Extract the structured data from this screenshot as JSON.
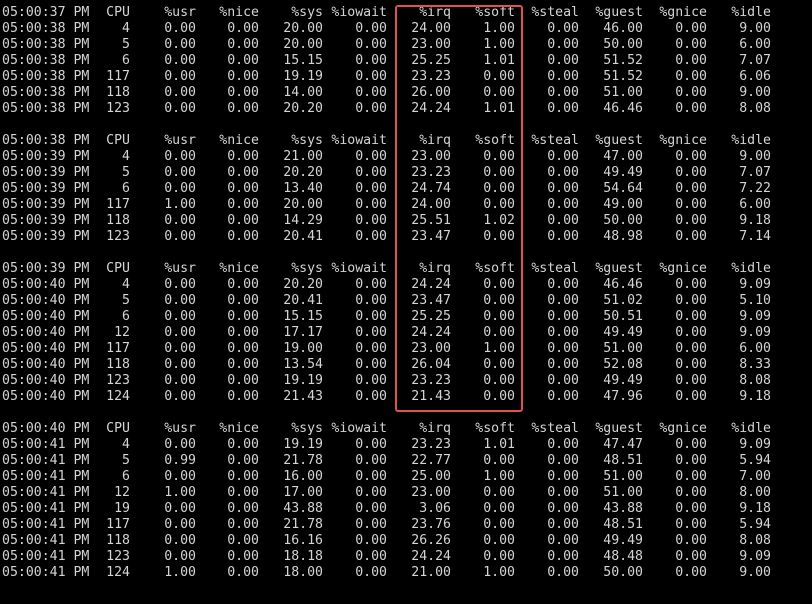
{
  "highlight_color": "#e0524f",
  "blocks": [
    {
      "header": [
        "05:00:37 PM",
        "CPU",
        "%usr",
        "%nice",
        "%sys",
        "%iowait",
        "%irq",
        "%soft",
        "%steal",
        "%guest",
        "%gnice",
        "%idle"
      ],
      "rows": [
        [
          "05:00:38 PM",
          "4",
          "0.00",
          "0.00",
          "20.00",
          "0.00",
          "24.00",
          "1.00",
          "0.00",
          "46.00",
          "0.00",
          "9.00"
        ],
        [
          "05:00:38 PM",
          "5",
          "0.00",
          "0.00",
          "20.00",
          "0.00",
          "23.00",
          "1.00",
          "0.00",
          "50.00",
          "0.00",
          "6.00"
        ],
        [
          "05:00:38 PM",
          "6",
          "0.00",
          "0.00",
          "15.15",
          "0.00",
          "25.25",
          "1.01",
          "0.00",
          "51.52",
          "0.00",
          "7.07"
        ],
        [
          "05:00:38 PM",
          "117",
          "0.00",
          "0.00",
          "19.19",
          "0.00",
          "23.23",
          "0.00",
          "0.00",
          "51.52",
          "0.00",
          "6.06"
        ],
        [
          "05:00:38 PM",
          "118",
          "0.00",
          "0.00",
          "14.00",
          "0.00",
          "26.00",
          "0.00",
          "0.00",
          "51.00",
          "0.00",
          "9.00"
        ],
        [
          "05:00:38 PM",
          "123",
          "0.00",
          "0.00",
          "20.20",
          "0.00",
          "24.24",
          "1.01",
          "0.00",
          "46.46",
          "0.00",
          "8.08"
        ]
      ]
    },
    {
      "header": [
        "05:00:38 PM",
        "CPU",
        "%usr",
        "%nice",
        "%sys",
        "%iowait",
        "%irq",
        "%soft",
        "%steal",
        "%guest",
        "%gnice",
        "%idle"
      ],
      "rows": [
        [
          "05:00:39 PM",
          "4",
          "0.00",
          "0.00",
          "21.00",
          "0.00",
          "23.00",
          "0.00",
          "0.00",
          "47.00",
          "0.00",
          "9.00"
        ],
        [
          "05:00:39 PM",
          "5",
          "0.00",
          "0.00",
          "20.20",
          "0.00",
          "23.23",
          "0.00",
          "0.00",
          "49.49",
          "0.00",
          "7.07"
        ],
        [
          "05:00:39 PM",
          "6",
          "0.00",
          "0.00",
          "13.40",
          "0.00",
          "24.74",
          "0.00",
          "0.00",
          "54.64",
          "0.00",
          "7.22"
        ],
        [
          "05:00:39 PM",
          "117",
          "1.00",
          "0.00",
          "20.00",
          "0.00",
          "24.00",
          "0.00",
          "0.00",
          "49.00",
          "0.00",
          "6.00"
        ],
        [
          "05:00:39 PM",
          "118",
          "0.00",
          "0.00",
          "14.29",
          "0.00",
          "25.51",
          "1.02",
          "0.00",
          "50.00",
          "0.00",
          "9.18"
        ],
        [
          "05:00:39 PM",
          "123",
          "0.00",
          "0.00",
          "20.41",
          "0.00",
          "23.47",
          "0.00",
          "0.00",
          "48.98",
          "0.00",
          "7.14"
        ]
      ]
    },
    {
      "header": [
        "05:00:39 PM",
        "CPU",
        "%usr",
        "%nice",
        "%sys",
        "%iowait",
        "%irq",
        "%soft",
        "%steal",
        "%guest",
        "%gnice",
        "%idle"
      ],
      "rows": [
        [
          "05:00:40 PM",
          "4",
          "0.00",
          "0.00",
          "20.20",
          "0.00",
          "24.24",
          "0.00",
          "0.00",
          "46.46",
          "0.00",
          "9.09"
        ],
        [
          "05:00:40 PM",
          "5",
          "0.00",
          "0.00",
          "20.41",
          "0.00",
          "23.47",
          "0.00",
          "0.00",
          "51.02",
          "0.00",
          "5.10"
        ],
        [
          "05:00:40 PM",
          "6",
          "0.00",
          "0.00",
          "15.15",
          "0.00",
          "25.25",
          "0.00",
          "0.00",
          "50.51",
          "0.00",
          "9.09"
        ],
        [
          "05:00:40 PM",
          "12",
          "0.00",
          "0.00",
          "17.17",
          "0.00",
          "24.24",
          "0.00",
          "0.00",
          "49.49",
          "0.00",
          "9.09"
        ],
        [
          "05:00:40 PM",
          "117",
          "0.00",
          "0.00",
          "19.00",
          "0.00",
          "23.00",
          "1.00",
          "0.00",
          "51.00",
          "0.00",
          "6.00"
        ],
        [
          "05:00:40 PM",
          "118",
          "0.00",
          "0.00",
          "13.54",
          "0.00",
          "26.04",
          "0.00",
          "0.00",
          "52.08",
          "0.00",
          "8.33"
        ],
        [
          "05:00:40 PM",
          "123",
          "0.00",
          "0.00",
          "19.19",
          "0.00",
          "23.23",
          "0.00",
          "0.00",
          "49.49",
          "0.00",
          "8.08"
        ],
        [
          "05:00:40 PM",
          "124",
          "0.00",
          "0.00",
          "21.43",
          "0.00",
          "21.43",
          "0.00",
          "0.00",
          "47.96",
          "0.00",
          "9.18"
        ]
      ]
    },
    {
      "header": [
        "05:00:40 PM",
        "CPU",
        "%usr",
        "%nice",
        "%sys",
        "%iowait",
        "%irq",
        "%soft",
        "%steal",
        "%guest",
        "%gnice",
        "%idle"
      ],
      "rows": [
        [
          "05:00:41 PM",
          "4",
          "0.00",
          "0.00",
          "19.19",
          "0.00",
          "23.23",
          "1.01",
          "0.00",
          "47.47",
          "0.00",
          "9.09"
        ],
        [
          "05:00:41 PM",
          "5",
          "0.99",
          "0.00",
          "21.78",
          "0.00",
          "22.77",
          "0.00",
          "0.00",
          "48.51",
          "0.00",
          "5.94"
        ],
        [
          "05:00:41 PM",
          "6",
          "0.00",
          "0.00",
          "16.00",
          "0.00",
          "25.00",
          "1.00",
          "0.00",
          "51.00",
          "0.00",
          "7.00"
        ],
        [
          "05:00:41 PM",
          "12",
          "1.00",
          "0.00",
          "17.00",
          "0.00",
          "23.00",
          "0.00",
          "0.00",
          "51.00",
          "0.00",
          "8.00"
        ],
        [
          "05:00:41 PM",
          "19",
          "0.00",
          "0.00",
          "43.88",
          "0.00",
          "3.06",
          "0.00",
          "0.00",
          "43.88",
          "0.00",
          "9.18"
        ],
        [
          "05:00:41 PM",
          "117",
          "0.00",
          "0.00",
          "21.78",
          "0.00",
          "23.76",
          "0.00",
          "0.00",
          "48.51",
          "0.00",
          "5.94"
        ],
        [
          "05:00:41 PM",
          "118",
          "0.00",
          "0.00",
          "16.16",
          "0.00",
          "26.26",
          "0.00",
          "0.00",
          "49.49",
          "0.00",
          "8.08"
        ],
        [
          "05:00:41 PM",
          "123",
          "0.00",
          "0.00",
          "18.18",
          "0.00",
          "24.24",
          "0.00",
          "0.00",
          "48.48",
          "0.00",
          "9.09"
        ],
        [
          "05:00:41 PM",
          "124",
          "1.00",
          "0.00",
          "18.00",
          "0.00",
          "21.00",
          "1.00",
          "0.00",
          "50.00",
          "0.00",
          "9.00"
        ]
      ]
    }
  ]
}
